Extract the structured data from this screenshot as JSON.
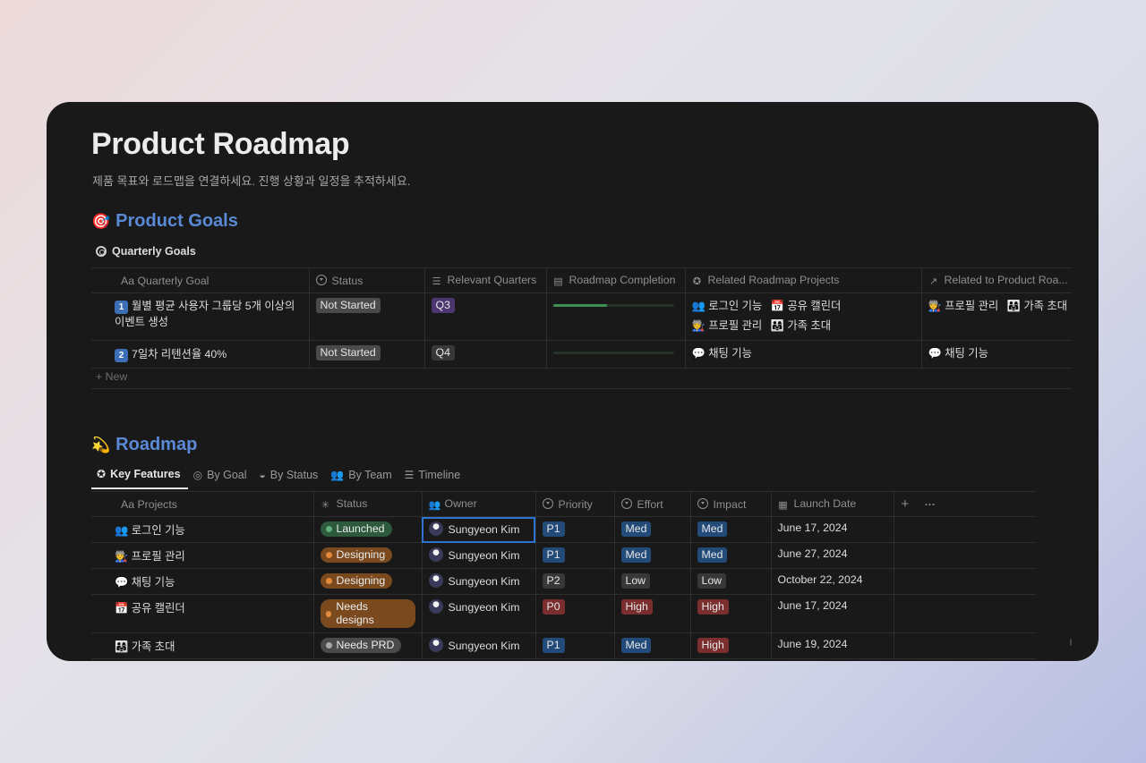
{
  "page": {
    "title": "Product Roadmap",
    "description": "제품 목표와 로드맵을 연결하세요. 진행 상황과 일정을 추적하세요."
  },
  "goals_section": {
    "emoji": "🎯",
    "title": "Product Goals",
    "db_title": "Quarterly Goals",
    "columns": [
      "Aa Quarterly Goal",
      "Status",
      "Relevant Quarters",
      "Roadmap Completion",
      "Related Roadmap Projects",
      "Related to Product Roa..."
    ],
    "rows": [
      {
        "num": "1",
        "goal": "월별 평균 사용자 그룹당 5개 이상의 이벤트 생성",
        "status": "Not Started",
        "quarter": "Q3",
        "completion": 0.45,
        "projects": [
          "👥 로그인 기능",
          "📅 공유 캘린더",
          "🧑‍🏭 프로필 관리",
          "👨‍👩‍👧 가족 초대"
        ],
        "related": [
          "🧑‍🏭 프로필 관리",
          "👨‍👩‍👧 가족 초대",
          "👤"
        ]
      },
      {
        "num": "2",
        "goal": "7일차 리텐션율 40%",
        "status": "Not Started",
        "quarter": "Q4",
        "completion": 0,
        "projects": [
          "💬 채팅 기능"
        ],
        "related": [
          "💬 채팅 기능"
        ]
      }
    ],
    "new_label": "New"
  },
  "roadmap_section": {
    "emoji": "💫",
    "title": "Roadmap",
    "tabs": [
      "Key Features",
      "By Goal",
      "By Status",
      "By Team",
      "Timeline"
    ],
    "columns": [
      "Aa Projects",
      "Status",
      "Owner",
      "Priority",
      "Effort",
      "Impact",
      "Launch Date"
    ],
    "add_icon": "+",
    "more_icon": "···",
    "rows": [
      {
        "emoji": "👥",
        "name": "로그인 기능",
        "status": "Launched",
        "owner": "Sungyeon Kim",
        "priority": "P1",
        "effort": "Med",
        "impact": "Med",
        "date": "June 17, 2024"
      },
      {
        "emoji": "🧑‍🏭",
        "name": "프로필 관리",
        "status": "Designing",
        "owner": "Sungyeon Kim",
        "priority": "P1",
        "effort": "Med",
        "impact": "Med",
        "date": "June 27, 2024"
      },
      {
        "emoji": "💬",
        "name": "채팅 기능",
        "status": "Designing",
        "owner": "Sungyeon Kim",
        "priority": "P2",
        "effort": "Low",
        "impact": "Low",
        "date": "October 22, 2024"
      },
      {
        "emoji": "📅",
        "name": "공유 캘린더",
        "status": "Needs designs",
        "owner": "Sungyeon Kim",
        "priority": "P0",
        "effort": "High",
        "impact": "High",
        "date": "June 17, 2024"
      },
      {
        "emoji": "👨‍👩‍👧",
        "name": "가족 초대",
        "status": "Needs PRD",
        "owner": "Sungyeon Kim",
        "priority": "P1",
        "effort": "Med",
        "impact": "High",
        "date": "June 19, 2024"
      }
    ]
  },
  "colors": {
    "window_bg": "#191919",
    "section_title": "#5a8ad6",
    "selection": "#2f73d0"
  }
}
